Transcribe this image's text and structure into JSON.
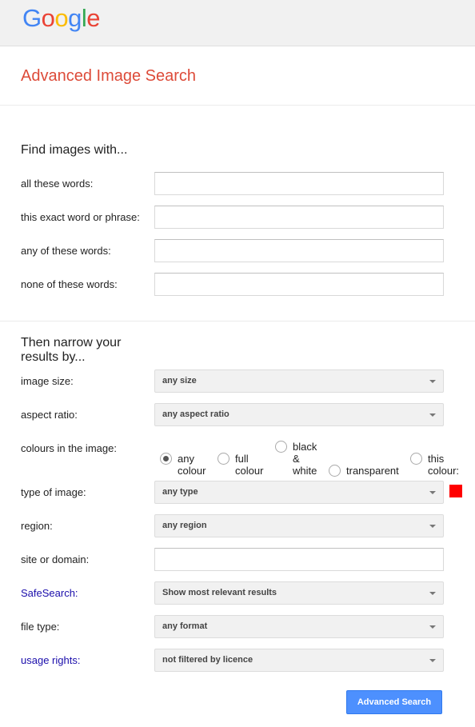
{
  "header": {
    "logo_letters": [
      "G",
      "o",
      "o",
      "g",
      "l",
      "e"
    ],
    "logo_colors": [
      "#4285f4",
      "#ea4335",
      "#fbbc05",
      "#4285f4",
      "#34a853",
      "#ea4335"
    ]
  },
  "page": {
    "title": "Advanced Image Search"
  },
  "find": {
    "heading": "Find images with...",
    "fields": [
      {
        "label": "all these words:",
        "value": ""
      },
      {
        "label": "this exact word or phrase:",
        "value": ""
      },
      {
        "label": "any of these words:",
        "value": ""
      },
      {
        "label": "none of these words:",
        "value": ""
      }
    ]
  },
  "narrow": {
    "heading_line1": "Then narrow your",
    "heading_line2": "results by...",
    "image_size": {
      "label": "image size:",
      "value": "any size"
    },
    "aspect_ratio": {
      "label": "aspect ratio:",
      "value": "any aspect ratio"
    },
    "colours": {
      "label": "colours in the image:",
      "options": [
        {
          "line1": "any",
          "line2": "colour",
          "line3": "",
          "checked": true
        },
        {
          "line1": "full",
          "line2": "colour",
          "line3": "",
          "checked": false
        },
        {
          "line1": "black",
          "line2": "&",
          "line3": "white",
          "checked": false
        },
        {
          "line1": "transparent",
          "line2": "",
          "line3": "",
          "checked": false
        },
        {
          "line1": "this",
          "line2": "colour:",
          "line3": "",
          "checked": false
        }
      ],
      "swatch_color": "#ff0000"
    },
    "type_of_image": {
      "label": "type of image:",
      "value": "any type"
    },
    "region": {
      "label": "region:",
      "value": "any region"
    },
    "site": {
      "label": "site or domain:",
      "value": ""
    },
    "safesearch": {
      "label": "SafeSearch:",
      "value": "Show most relevant results"
    },
    "file_type": {
      "label": "file type:",
      "value": "any format"
    },
    "usage_rights": {
      "label": "usage rights:",
      "value": "not filtered by licence"
    }
  },
  "actions": {
    "submit_label": "Advanced Search"
  },
  "colors": {
    "title": "#dd4b39",
    "link": "#1a0dab",
    "button": "#4d90fe"
  }
}
